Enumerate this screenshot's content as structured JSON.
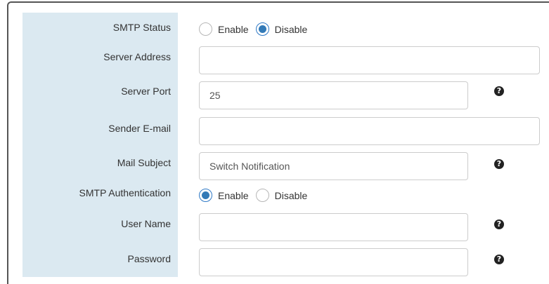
{
  "form": {
    "smtp_status": {
      "label": "SMTP Status",
      "options": [
        "Enable",
        "Disable"
      ],
      "selected": "Disable"
    },
    "server_address": {
      "label": "Server Address",
      "value": ""
    },
    "server_port": {
      "label": "Server Port",
      "value": "25"
    },
    "sender_email": {
      "label": "Sender E-mail",
      "value": ""
    },
    "mail_subject": {
      "label": "Mail Subject",
      "value": "Switch Notification"
    },
    "smtp_authentication": {
      "label": "SMTP Authentication",
      "options": [
        "Enable",
        "Disable"
      ],
      "selected": "Enable"
    },
    "user_name": {
      "label": "User Name",
      "value": ""
    },
    "password": {
      "label": "Password",
      "value": ""
    },
    "help_icon": "question-circle-icon"
  }
}
